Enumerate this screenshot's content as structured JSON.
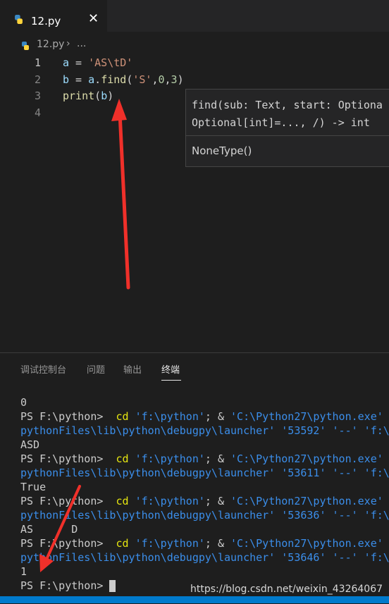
{
  "tab": {
    "label": "12.py",
    "close": "✕"
  },
  "breadcrumb": {
    "file": "12.py",
    "sep": "›",
    "more": "..."
  },
  "editor": {
    "line_numbers": [
      "1",
      "2",
      "3",
      "4"
    ],
    "lines": [
      {
        "parts": [
          [
            "var",
            "a"
          ],
          [
            "plain",
            " = "
          ],
          [
            "str",
            "'AS\\tD'"
          ]
        ]
      },
      {
        "parts": [
          [
            "var",
            "b"
          ],
          [
            "plain",
            " = "
          ],
          [
            "var",
            "a"
          ],
          [
            "plain",
            "."
          ],
          [
            "fn",
            "find"
          ],
          [
            "plain",
            "("
          ],
          [
            "str",
            "'S'"
          ],
          [
            "plain",
            ","
          ],
          [
            "num",
            "0"
          ],
          [
            "plain",
            ","
          ],
          [
            "num",
            "3"
          ],
          [
            "plain",
            ")"
          ]
        ]
      },
      {
        "parts": [
          [
            "fn",
            "print"
          ],
          [
            "plain",
            "("
          ],
          [
            "var",
            "b"
          ],
          [
            "plain",
            ")"
          ]
        ]
      },
      {
        "parts": []
      }
    ]
  },
  "hover": {
    "signature_line1": "find(sub: Text, start: Optiona",
    "signature_line2": "Optional[int]=..., /) -> int",
    "return_type": "NoneType()"
  },
  "panel": {
    "tabs": [
      "调试控制台",
      "问题",
      "输出",
      "终端"
    ],
    "active_tab": "终端"
  },
  "terminal": {
    "lines": [
      {
        "parts": [
          [
            "plain",
            "0"
          ]
        ]
      },
      {
        "parts": [
          [
            "plain",
            "PS F:\\python> "
          ],
          [
            "cmd",
            " cd"
          ],
          [
            "plain",
            " "
          ],
          [
            "str",
            "'f:\\python'"
          ],
          [
            "plain",
            "; & "
          ],
          [
            "str",
            "'C:\\Python27\\python.exe'"
          ]
        ]
      },
      {
        "parts": [
          [
            "str",
            "pythonFiles\\lib\\python\\debugpy\\launcher'"
          ],
          [
            "plain",
            " "
          ],
          [
            "str",
            "'53592'"
          ],
          [
            "plain",
            " "
          ],
          [
            "str",
            "'--'"
          ],
          [
            "plain",
            " "
          ],
          [
            "str",
            "'f:\\"
          ]
        ]
      },
      {
        "parts": [
          [
            "plain",
            "ASD"
          ]
        ]
      },
      {
        "parts": [
          [
            "plain",
            "PS F:\\python> "
          ],
          [
            "cmd",
            " cd"
          ],
          [
            "plain",
            " "
          ],
          [
            "str",
            "'f:\\python'"
          ],
          [
            "plain",
            "; & "
          ],
          [
            "str",
            "'C:\\Python27\\python.exe'"
          ]
        ]
      },
      {
        "parts": [
          [
            "str",
            "pythonFiles\\lib\\python\\debugpy\\launcher'"
          ],
          [
            "plain",
            " "
          ],
          [
            "str",
            "'53611'"
          ],
          [
            "plain",
            " "
          ],
          [
            "str",
            "'--'"
          ],
          [
            "plain",
            " "
          ],
          [
            "str",
            "'f:\\"
          ]
        ]
      },
      {
        "parts": [
          [
            "plain",
            "True"
          ]
        ]
      },
      {
        "parts": [
          [
            "plain",
            "PS F:\\python> "
          ],
          [
            "cmd",
            " cd"
          ],
          [
            "plain",
            " "
          ],
          [
            "str",
            "'f:\\python'"
          ],
          [
            "plain",
            "; & "
          ],
          [
            "str",
            "'C:\\Python27\\python.exe'"
          ]
        ]
      },
      {
        "parts": [
          [
            "str",
            "pythonFiles\\lib\\python\\debugpy\\launcher'"
          ],
          [
            "plain",
            " "
          ],
          [
            "str",
            "'53636'"
          ],
          [
            "plain",
            " "
          ],
          [
            "str",
            "'--'"
          ],
          [
            "plain",
            " "
          ],
          [
            "str",
            "'f:\\"
          ]
        ]
      },
      {
        "parts": [
          [
            "plain",
            "AS      D"
          ]
        ]
      },
      {
        "parts": [
          [
            "plain",
            "PS F:\\python> "
          ],
          [
            "cmd",
            " cd"
          ],
          [
            "plain",
            " "
          ],
          [
            "str",
            "'f:\\python'"
          ],
          [
            "plain",
            "; & "
          ],
          [
            "str",
            "'C:\\Python27\\python.exe'"
          ]
        ]
      },
      {
        "parts": [
          [
            "str",
            "pythonFiles\\lib\\python\\debugpy\\launcher'"
          ],
          [
            "plain",
            " "
          ],
          [
            "str",
            "'53646'"
          ],
          [
            "plain",
            " "
          ],
          [
            "str",
            "'--'"
          ],
          [
            "plain",
            " "
          ],
          [
            "str",
            "'f:\\"
          ]
        ]
      },
      {
        "parts": [
          [
            "plain",
            "1"
          ]
        ]
      },
      {
        "parts": [
          [
            "plain",
            "PS F:\\python> "
          ]
        ]
      }
    ]
  },
  "watermark": "https://blog.csdn.net/weixin_43264067",
  "colors": {
    "accent": "#007acc",
    "annotation_arrow": "#f0302a"
  }
}
